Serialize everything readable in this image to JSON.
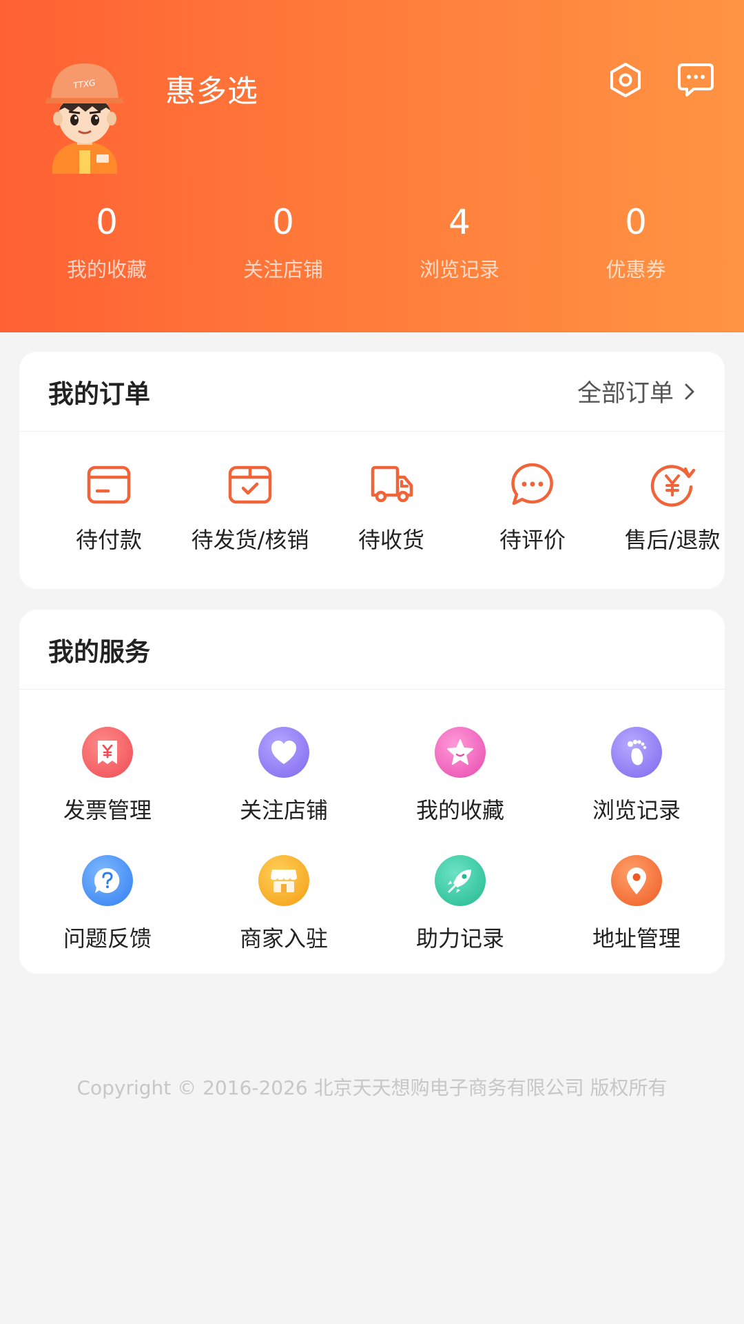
{
  "header": {
    "username": "惠多选",
    "stats": [
      {
        "value": "0",
        "label": "我的收藏"
      },
      {
        "value": "0",
        "label": "关注店铺"
      },
      {
        "value": "4",
        "label": "浏览记录"
      },
      {
        "value": "0",
        "label": "优惠券"
      }
    ],
    "icons": {
      "settings": "settings-hexagon-icon",
      "message": "message-bubble-icon"
    }
  },
  "orders": {
    "title": "我的订单",
    "all_label": "全部订单",
    "items": [
      {
        "label": "待付款",
        "icon": "wallet-card-icon"
      },
      {
        "label": "待发货/核销",
        "icon": "box-check-icon"
      },
      {
        "label": "待收货",
        "icon": "delivery-truck-icon"
      },
      {
        "label": "待评价",
        "icon": "comment-dots-icon"
      },
      {
        "label": "售后/退款",
        "icon": "yen-refund-icon"
      }
    ]
  },
  "services": {
    "title": "我的服务",
    "items": [
      {
        "label": "发票管理",
        "icon": "invoice-icon",
        "color": "#f0555d"
      },
      {
        "label": "关注店铺",
        "icon": "heart-icon",
        "color": "#8a73f2"
      },
      {
        "label": "我的收藏",
        "icon": "star-icon",
        "color": "#ee5db8"
      },
      {
        "label": "浏览记录",
        "icon": "footprint-icon",
        "color": "#8a78f0"
      },
      {
        "label": "问题反馈",
        "icon": "question-icon",
        "color": "#3a8df5"
      },
      {
        "label": "商家入驻",
        "icon": "store-icon",
        "color": "#f7a520"
      },
      {
        "label": "助力记录",
        "icon": "rocket-icon",
        "color": "#34c9a3"
      },
      {
        "label": "地址管理",
        "icon": "location-pin-icon",
        "color": "#f4682e"
      }
    ]
  },
  "footer": {
    "copyright": "Copyright © 2016-2026 北京天天想购电子商务有限公司 版权所有"
  },
  "colors": {
    "brand": "#ff6b35",
    "accent_icon": "#f0643a"
  }
}
